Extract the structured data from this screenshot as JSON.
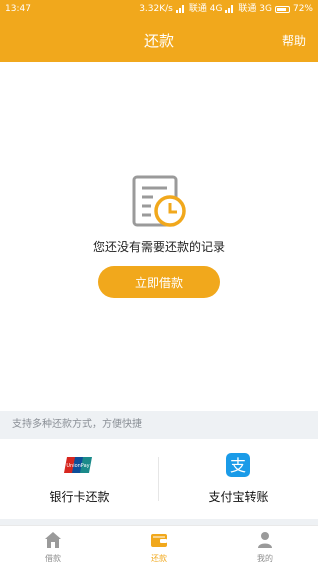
{
  "status_bar": {
    "time": "13:47",
    "net_speed": "3.32K/s",
    "carrier1": "联通 4G",
    "carrier2": "联通 3G",
    "battery": "72%"
  },
  "header": {
    "title": "还款",
    "help_label": "帮助",
    "accent_color": "#f1a81c"
  },
  "empty_state": {
    "icon": "records-clock-icon",
    "message": "您还没有需要还款的记录",
    "button_label": "立即借款"
  },
  "payment_methods": {
    "section_label": "支持多种还款方式，方便快捷",
    "items": [
      {
        "icon": "unionpay-icon",
        "label": "银行卡还款"
      },
      {
        "icon": "alipay-icon",
        "label": "支付宝转账"
      }
    ]
  },
  "tabs": [
    {
      "icon": "home-icon",
      "label": "借款",
      "active": false
    },
    {
      "icon": "wallet-icon",
      "label": "还款",
      "active": true
    },
    {
      "icon": "user-icon",
      "label": "我的",
      "active": false
    }
  ]
}
